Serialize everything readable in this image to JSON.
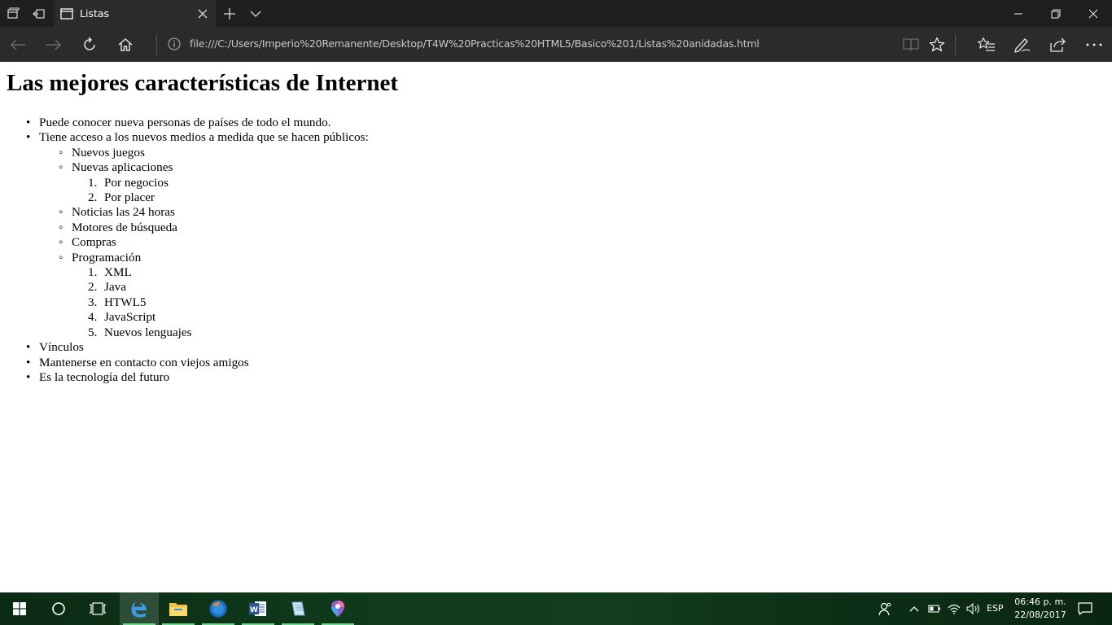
{
  "browser": {
    "tab": {
      "title": "Listas"
    },
    "address": {
      "url": "file:///C:/Users/Imperio%20Remanente/Desktop/T4W%20Practicas%20HTML5/Basico%201/Listas%20anidadas.html"
    }
  },
  "page": {
    "heading": "Las mejores características de Internet",
    "items": {
      "i1": "Puede conocer nueva personas de países de todo el mundo.",
      "i2": "Tiene acceso a los nuevos medios a medida que se hacen públicos:",
      "sub": {
        "s1": "Nuevos juegos",
        "s2": "Nuevas aplicaciones",
        "s2_1": "Por negocios",
        "s2_2": "Por placer",
        "s3": "Noticias las 24 horas",
        "s4": "Motores de búsqueda",
        "s5": "Compras",
        "s6": "Programación",
        "s6_1": "XML",
        "s6_2": "Java",
        "s6_3": "HTWL5",
        "s6_4": "JavaScript",
        "s6_5": "Nuevos lenguajes"
      },
      "i3": "Vínculos",
      "i4": "Mantenerse en contacto con viejos amigos",
      "i5": "Es la tecnología del futuro"
    },
    "bullets": {
      "disc": "•",
      "circle": "◦"
    },
    "numbers": {
      "n1": "1.",
      "n2": "2.",
      "n3": "3.",
      "n4": "4.",
      "n5": "5."
    }
  },
  "taskbar": {
    "lang": "ESP",
    "time": "06:46 p. m.",
    "date": "22/08/2017"
  },
  "colors": {
    "titlebar": "#1f1f1f",
    "toolbar": "#2b2b2b",
    "edge_blue": "#1e90ff",
    "taskbar": "#0f3a1a"
  }
}
